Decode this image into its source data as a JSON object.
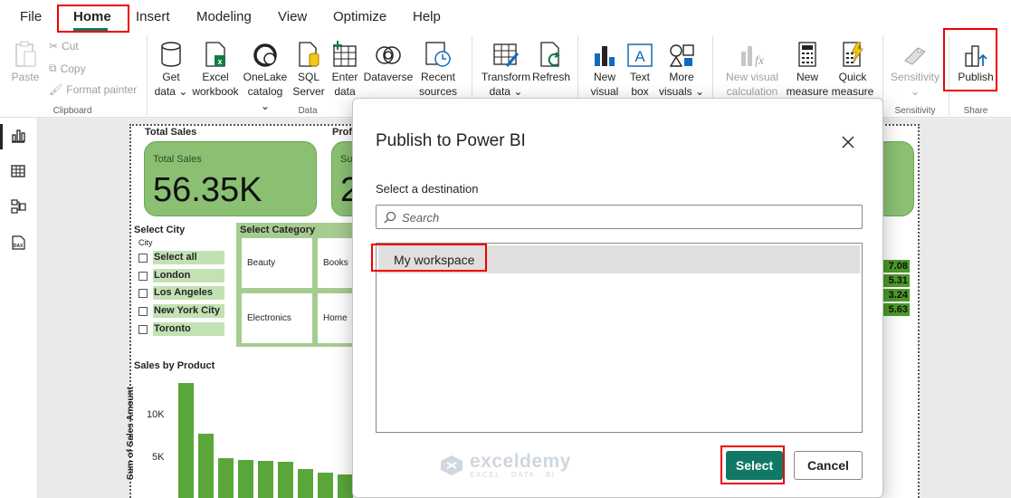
{
  "menu": {
    "items": [
      "File",
      "Home",
      "Insert",
      "Modeling",
      "View",
      "Optimize",
      "Help"
    ],
    "active": "Home"
  },
  "ribbon": {
    "clipboard": {
      "paste": "Paste",
      "cut": "Cut",
      "copy": "Copy",
      "format_painter": "Format painter",
      "group_label": "Clipboard"
    },
    "data": {
      "get_data": [
        "Get",
        "data ⌄"
      ],
      "excel": [
        "Excel",
        "workbook"
      ],
      "onelake": [
        "OneLake",
        "catalog ⌄"
      ],
      "sql": [
        "SQL",
        "Server"
      ],
      "enter_data": [
        "Enter",
        "data"
      ],
      "dataverse": [
        "Dataverse"
      ],
      "recent_sources": [
        "Recent",
        "sources ⌄"
      ],
      "group_label": "Data"
    },
    "queries": {
      "transform": [
        "Transform",
        "data ⌄"
      ],
      "refresh": [
        "Refresh"
      ]
    },
    "insert": {
      "new_visual": [
        "New",
        "visual"
      ],
      "text_box": [
        "Text",
        "box"
      ],
      "more_visuals": [
        "More",
        "visuals ⌄"
      ]
    },
    "calculations": {
      "new_visual_calc": [
        "New visual",
        "calculation ⌄"
      ],
      "new_measure": [
        "New",
        "measure"
      ],
      "quick_measure": [
        "Quick",
        "measure"
      ]
    },
    "sensitivity": {
      "label": [
        "Sensitivity",
        "⌄"
      ],
      "group_label": "Sensitivity"
    },
    "share": {
      "publish": "Publish",
      "group_label": "Share"
    }
  },
  "report": {
    "total_sales_title": "Total Sales",
    "total_sales_card_label": "Total Sales",
    "total_sales_value": "56.35K",
    "profit_title": "Prof",
    "profit_card_label": "Su",
    "profit_value": "2",
    "city_slicer": {
      "title": "Select City",
      "header": "City",
      "items": [
        "Select all",
        "London",
        "Los Angeles",
        "New York City",
        "Toronto"
      ]
    },
    "category_slicer": {
      "title": "Select Category",
      "tiles": [
        "Beauty",
        "Books",
        "Electronics",
        "Home"
      ]
    },
    "partial_values": [
      "7.08",
      "5.31",
      "3.24",
      "5.63"
    ],
    "sales_chart": {
      "title": "Sales by Product",
      "ylabel": "Sum of Sales Amount",
      "ticks": [
        "10K",
        "5K"
      ]
    }
  },
  "chart_data": {
    "type": "bar",
    "title": "Sales by Product",
    "xlabel": "",
    "ylabel": "Sum of Sales Amount",
    "y_ticks": [
      "10K",
      "5K"
    ],
    "values": [
      13700,
      7800,
      4900,
      4700,
      4600,
      4500,
      3600,
      3200,
      3000
    ]
  },
  "modal": {
    "title": "Publish to Power BI",
    "subtitle": "Select a destination",
    "search_placeholder": "Search",
    "workspaces": [
      "My workspace"
    ],
    "select_label": "Select",
    "cancel_label": "Cancel"
  },
  "watermark": {
    "main": "exceldemy",
    "sub": "EXCEL · DATA · BI"
  },
  "colors": {
    "accent": "#117865",
    "card": "#8bc073",
    "bar": "#5aa63a",
    "highlight": "#e00000"
  }
}
